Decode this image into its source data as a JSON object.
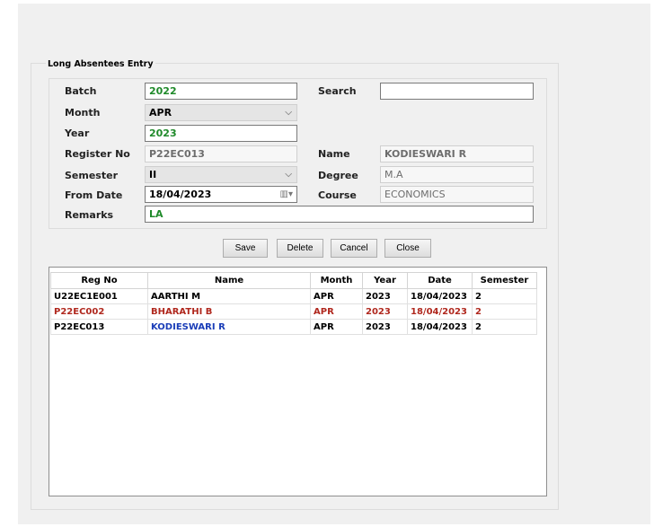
{
  "form": {
    "group_title": "Long Absentees Entry",
    "labels": {
      "batch": "Batch",
      "month": "Month",
      "year": "Year",
      "register_no": "Register No",
      "semester": "Semester",
      "from_date": "From Date",
      "remarks": "Remarks",
      "search": "Search",
      "name": "Name",
      "degree": "Degree",
      "course": "Course"
    },
    "values": {
      "batch": "2022",
      "month": "APR",
      "year": "2023",
      "register_no": "P22EC013",
      "semester": "II",
      "from_date": "18/04/2023",
      "remarks": "LA",
      "search": "",
      "name": "KODIESWARI R",
      "degree": "M.A",
      "course": "ECONOMICS"
    }
  },
  "buttons": {
    "save": "Save",
    "delete": "Delete",
    "cancel": "Cancel",
    "close": "Close"
  },
  "grid": {
    "columns": [
      "Reg No",
      "Name",
      "Month",
      "Year",
      "Date",
      "Semester"
    ],
    "rows": [
      {
        "reg_no": "U22EC1E001",
        "name": "AARTHI M",
        "month": "APR",
        "year": "2023",
        "date": "18/04/2023",
        "semester": "2"
      },
      {
        "reg_no": "P22EC002",
        "name": "BHARATHI B",
        "month": "APR",
        "year": "2023",
        "date": "18/04/2023",
        "semester": "2"
      },
      {
        "reg_no": "P22EC013",
        "name": "KODIESWARI R",
        "month": "APR",
        "year": "2023",
        "date": "18/04/2023",
        "semester": "2"
      }
    ]
  },
  "colors": {
    "window_bg": "#f0f0f0",
    "value_green": "#1f8a2a",
    "row_highlight": "#b0281e",
    "name_blue": "#1a3db8"
  }
}
